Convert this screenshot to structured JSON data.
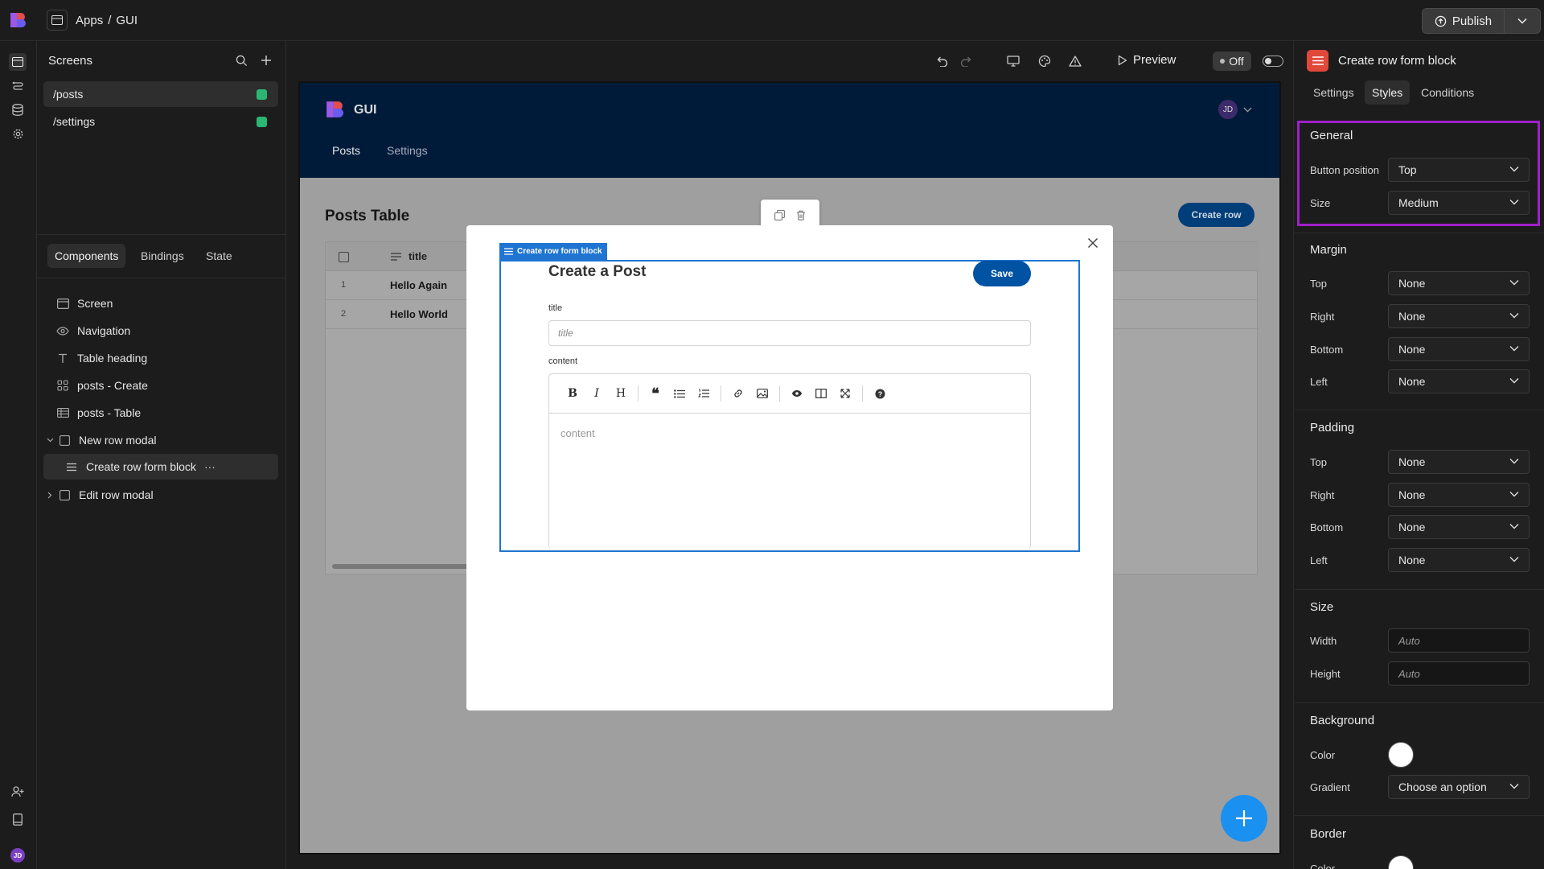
{
  "breadcrumb": {
    "apps": "Apps",
    "sep": "/",
    "app": "GUI"
  },
  "publish": {
    "label": "Publish"
  },
  "screens_panel": {
    "title": "Screens",
    "screens": [
      {
        "route": "/posts"
      },
      {
        "route": "/settings"
      }
    ]
  },
  "left_tabs": {
    "components": "Components",
    "bindings": "Bindings",
    "state": "State"
  },
  "tree": {
    "screen": "Screen",
    "navigation": "Navigation",
    "table_heading": "Table heading",
    "posts_create": "posts - Create",
    "posts_table": "posts - Table",
    "new_row_modal": "New row modal",
    "create_row_form_block": "Create row form block",
    "create_row_more": "···",
    "edit_row_modal": "Edit row modal"
  },
  "canvas_toolbar": {
    "preview": "Preview",
    "toggle": "Off"
  },
  "app": {
    "name": "GUI",
    "nav": {
      "posts": "Posts",
      "settings": "Settings"
    },
    "avatar": "JD",
    "table_heading": "Posts Table",
    "create_row": "Create row",
    "table": {
      "col_title": "title",
      "rows": [
        {
          "index": "1",
          "title": "Hello Again"
        },
        {
          "index": "2",
          "title": "Hello World"
        }
      ]
    },
    "form": {
      "tag": "Create row form block",
      "heading": "Create a Post",
      "save": "Save",
      "title_label": "title",
      "title_placeholder": "title",
      "content_label": "content",
      "content_placeholder": "content"
    }
  },
  "right_panel": {
    "title": "Create row form block",
    "tabs": {
      "settings": "Settings",
      "styles": "Styles",
      "conditions": "Conditions"
    },
    "general": {
      "title": "General",
      "button_position_label": "Button position",
      "button_position": "Top",
      "size_label": "Size",
      "size": "Medium"
    },
    "margin": {
      "title": "Margin",
      "top_label": "Top",
      "top": "None",
      "right_label": "Right",
      "right": "None",
      "bottom_label": "Bottom",
      "bottom": "None",
      "left_label": "Left",
      "left": "None"
    },
    "padding": {
      "title": "Padding",
      "top_label": "Top",
      "top": "None",
      "right_label": "Right",
      "right": "None",
      "bottom_label": "Bottom",
      "bottom": "None",
      "left_label": "Left",
      "left": "None"
    },
    "size": {
      "title": "Size",
      "width_label": "Width",
      "width_placeholder": "Auto",
      "height_label": "Height",
      "height_placeholder": "Auto"
    },
    "background": {
      "title": "Background",
      "color_label": "Color",
      "gradient_label": "Gradient",
      "gradient": "Choose an option"
    },
    "border": {
      "title": "Border",
      "color_label": "Color"
    }
  },
  "user_avatar": "JD",
  "colors": {
    "accent": "#0052a3",
    "highlight": "#a020c8",
    "selection": "#1f75d1",
    "nav_bg": "#001b3a",
    "status_green": "#2bb673"
  }
}
